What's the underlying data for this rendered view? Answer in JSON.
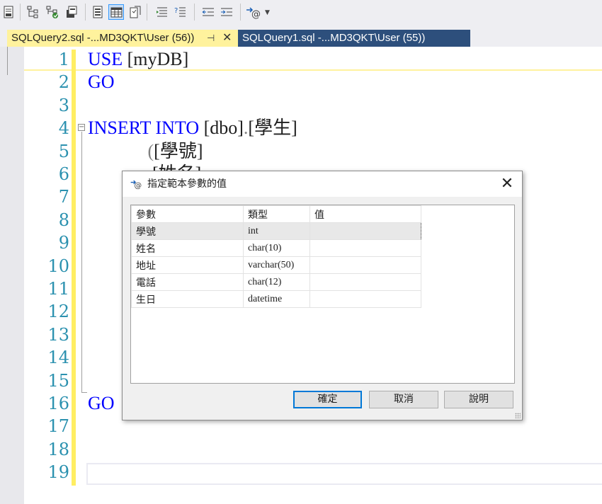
{
  "toolbar": {
    "buttons": [
      "results-to-text",
      "display-plan",
      "include-stats",
      "query-options",
      "results-to-file",
      "results-to-grid",
      "parse",
      "comment",
      "uncomment",
      "decrease-indent",
      "increase-indent",
      "specify-template-parameters"
    ]
  },
  "tabs": [
    {
      "label": "SQLQuery2.sql -...MD3QKT\\User (56))",
      "active": true,
      "pin": "⊣",
      "close": "✕"
    },
    {
      "label": "SQLQuery1.sql -...MD3QKT\\User (55))",
      "active": false
    }
  ],
  "editor": {
    "line_numbers": [
      "1",
      "2",
      "3",
      "4",
      "5",
      "6",
      "7",
      "8",
      "9",
      "10",
      "11",
      "12",
      "13",
      "14",
      "15",
      "16",
      "17",
      "18",
      "19"
    ],
    "lines": [
      [
        {
          "t": "USE",
          "k": "kw"
        },
        {
          "t": " [myDB]",
          "k": ""
        }
      ],
      [
        {
          "t": "GO",
          "k": "kw"
        }
      ],
      [],
      [
        {
          "t": "INSERT",
          "k": "kw"
        },
        {
          "t": " ",
          "k": ""
        },
        {
          "t": "INTO",
          "k": "kw"
        },
        {
          "t": " [dbo]",
          "k": ""
        },
        {
          "t": ".",
          "k": "gray"
        },
        {
          "t": "[學生]",
          "k": ""
        }
      ],
      [
        {
          "t": "             ",
          "k": ""
        },
        {
          "t": "(",
          "k": "gray"
        },
        {
          "t": "[學號]",
          "k": ""
        }
      ],
      [
        {
          "t": "              [姓名]",
          "k": ""
        }
      ],
      [],
      [],
      [],
      [],
      [],
      [],
      [],
      [],
      [],
      [
        {
          "t": "GO",
          "k": "kw"
        }
      ],
      [],
      [],
      []
    ]
  },
  "dialog": {
    "title": "指定範本參數的值",
    "close": "✕",
    "columns": [
      "參數",
      "類型",
      "值"
    ],
    "rows": [
      {
        "name": "學號",
        "type": "int",
        "value": ""
      },
      {
        "name": "姓名",
        "type": "char(10)",
        "value": ""
      },
      {
        "name": "地址",
        "type": "varchar(50)",
        "value": ""
      },
      {
        "name": "電話",
        "type": "char(12)",
        "value": ""
      },
      {
        "name": "生日",
        "type": "datetime",
        "value": ""
      }
    ],
    "buttons": {
      "ok": "確定",
      "cancel": "取消",
      "help": "說明"
    }
  }
}
